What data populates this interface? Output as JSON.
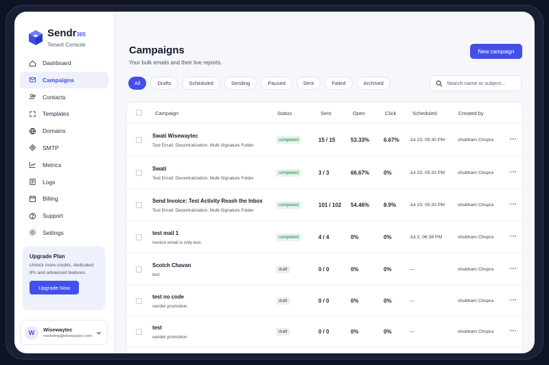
{
  "brand": {
    "name": "Sendr",
    "num": "365",
    "subtitle": "Tenant Console"
  },
  "nav": [
    {
      "label": "Dashboard",
      "icon": "home-icon"
    },
    {
      "label": "Campaigns",
      "icon": "mail-icon",
      "active": true
    },
    {
      "label": "Contacts",
      "icon": "users-icon"
    },
    {
      "label": "Templates",
      "icon": "template-icon"
    },
    {
      "label": "Domains",
      "icon": "globe-icon"
    },
    {
      "label": "SMTP",
      "icon": "server-icon"
    },
    {
      "label": "Metrics",
      "icon": "chart-icon"
    },
    {
      "label": "Logs",
      "icon": "logs-icon"
    },
    {
      "label": "Billing",
      "icon": "billing-icon"
    },
    {
      "label": "Support",
      "icon": "help-icon"
    },
    {
      "label": "Settings",
      "icon": "gear-icon"
    }
  ],
  "upgrade": {
    "title": "Upgrade Plan",
    "text": "Unlock more credits, dedicated IPs and advanced features.",
    "button": "Upgrade Now"
  },
  "user": {
    "initial": "W",
    "name": "Wisewaytec",
    "email": "marketing@wisewaytec.com"
  },
  "page": {
    "title": "Campaigns",
    "subtitle": "Your bulk emails and their live reports.",
    "new_button": "New campaign"
  },
  "tabs": [
    "All",
    "Drafts",
    "Scheduled",
    "Sending",
    "Paused",
    "Sent",
    "Failed",
    "Archived"
  ],
  "active_tab": "All",
  "search": {
    "placeholder": "Search name or subject..."
  },
  "table": {
    "headers": [
      "Campaign",
      "Status",
      "Sent",
      "Open",
      "Click",
      "Scheduled",
      "Created by"
    ],
    "rows": [
      {
        "name": "Swati Wisewaytec",
        "subject": "Test Email: Decentralization, Multi-Signature Folder",
        "status": "completed",
        "sent": "15 / 15",
        "open": "53.33%",
        "click": "6.67%",
        "scheduled": "Jul 23, 05:30 PM",
        "created_by": "shubham Chopra"
      },
      {
        "name": "Swati",
        "subject": "Test Email: Decentralization, Multi-Signature Folder",
        "status": "completed",
        "sent": "3 / 3",
        "open": "66.67%",
        "click": "0%",
        "scheduled": "Jul 23, 05:31 PM",
        "created_by": "shubham Chopra"
      },
      {
        "name": "Send Invoice: Test Activity Reash the Inbox",
        "subject": "Test Email: Decentralization, Multi-Signature Folder",
        "status": "completed",
        "sent": "101 / 102",
        "open": "54.46%",
        "click": "8.9%",
        "scheduled": "Jul 23, 05:20 PM",
        "created_by": "shubham Chopra"
      },
      {
        "name": "test mail 1",
        "subject": "invoice email is only test.",
        "status": "completed",
        "sent": "4 / 4",
        "open": "0%",
        "click": "0%",
        "scheduled": "Jul 2, 06:38 PM",
        "created_by": "shubham Chopra"
      },
      {
        "name": "Scotch Chavan",
        "subject": "test",
        "status": "draft",
        "sent": "0 / 0",
        "open": "0%",
        "click": "0%",
        "scheduled": "—",
        "created_by": "shubham Chopra"
      },
      {
        "name": "test no code",
        "subject": "sender promotion",
        "status": "draft",
        "sent": "0 / 0",
        "open": "0%",
        "click": "0%",
        "scheduled": "—",
        "created_by": "shubham Chopra"
      },
      {
        "name": "test",
        "subject": "sender promotion",
        "status": "draft",
        "sent": "0 / 0",
        "open": "0%",
        "click": "0%",
        "scheduled": "—",
        "created_by": "shubham Chopra"
      }
    ],
    "row_action": "···"
  },
  "colors": {
    "accent": "#4350e8",
    "completed_bg": "#e3f5ea",
    "completed_text": "#1d7a45",
    "draft_bg": "#edeef2"
  }
}
